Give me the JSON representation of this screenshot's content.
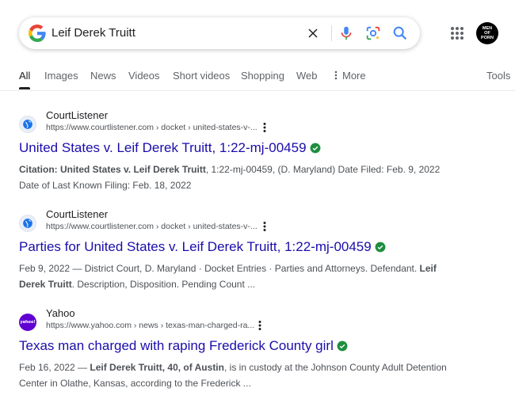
{
  "search": {
    "query": "Leif Derek Truitt"
  },
  "account": {
    "avatar_lines": [
      "MEN",
      "OF",
      "PORN"
    ]
  },
  "tabs": [
    {
      "label": "All",
      "active": true
    },
    {
      "label": "Images"
    },
    {
      "label": "News"
    },
    {
      "label": "Videos"
    },
    {
      "label": "Short videos"
    },
    {
      "label": "Shopping"
    },
    {
      "label": "Web"
    },
    {
      "label": "More",
      "icon": "vertical-dots-icon"
    },
    {
      "label": "Tools"
    }
  ],
  "results": [
    {
      "site_name": "CourtListener",
      "url": "https://www.courtlistener.com › docket › united-states-v-...",
      "title": "United States v. Leif Derek Truitt, 1:22-mj-00459",
      "snippet_bold_1": "Citation: United States v. Leif Derek Truitt",
      "snippet_1": ", 1:22-mj-00459, (D. Maryland) Date Filed: Feb. 9, 2022",
      "snippet_2": "Date of Last Known Filing: Feb. 18, 2022"
    },
    {
      "site_name": "CourtListener",
      "url": "https://www.courtlistener.com › docket › united-states-v-...",
      "title": "Parties for United States v. Leif Derek Truitt, 1:22-mj-00459",
      "snippet_1": "Feb 9, 2022 — District Court, D. Maryland · Docket Entries · Parties and Attorneys. Defendant. ",
      "snippet_bold_1": "Leif",
      "snippet_bold_2": "Derek Truitt",
      "snippet_2": ". Description, Disposition. Pending Count ..."
    },
    {
      "site_name": "Yahoo",
      "favicon_text": "yahoo!",
      "url": "https://www.yahoo.com › news › texas-man-charged-ra...",
      "title": "Texas man charged with raping Frederick County girl",
      "snippet_1": "Feb 16, 2022 — ",
      "snippet_bold_1": "Leif Derek Truitt, 40, of Austin",
      "snippet_2": ", is in custody at the Johnson County Adult Detention",
      "snippet_3": "Center in Olathe, Kansas, according to the Frederick ..."
    }
  ],
  "colors": {
    "link": "#1a0dab",
    "verified": "#1e8e3e",
    "yahoo": "#6001d2"
  }
}
